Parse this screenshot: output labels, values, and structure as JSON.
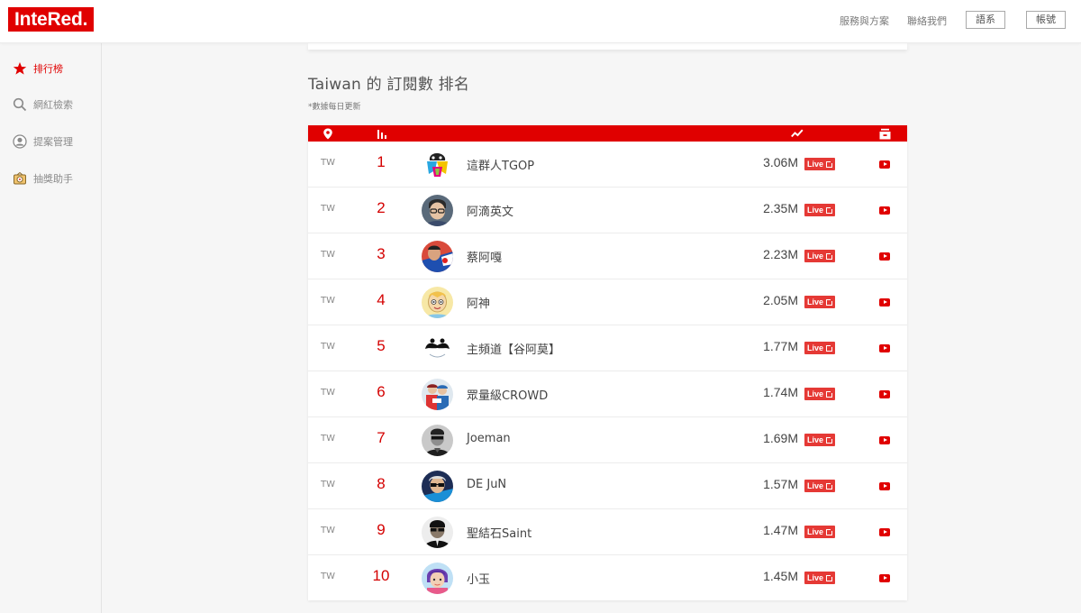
{
  "header": {
    "logo": "InteRed.",
    "nav_services": "服務與方案",
    "nav_contact": "聯絡我們",
    "btn_language": "語系",
    "btn_account": "帳號"
  },
  "sidebar": {
    "items": [
      {
        "label": "排行榜",
        "icon": "star-icon",
        "active": true
      },
      {
        "label": "網紅檢索",
        "icon": "search-icon",
        "active": false
      },
      {
        "label": "提案管理",
        "icon": "user-icon",
        "active": false
      },
      {
        "label": "抽獎助手",
        "icon": "lottery-icon",
        "active": false
      }
    ]
  },
  "main": {
    "title": "Taiwan 的 訂閱數 排名",
    "note": "*數據每日更新",
    "header_icons": [
      "location-pin-icon",
      "bar-chart-icon",
      "trend-line-icon",
      "platform-icon"
    ],
    "live_label": "Live",
    "rows": [
      {
        "country": "TW",
        "rank": "1",
        "name": "這群人TGOP",
        "subs": "3.06M"
      },
      {
        "country": "TW",
        "rank": "2",
        "name": "阿滴英文",
        "subs": "2.35M"
      },
      {
        "country": "TW",
        "rank": "3",
        "name": "蔡阿嘎",
        "subs": "2.23M"
      },
      {
        "country": "TW",
        "rank": "4",
        "name": "阿神",
        "subs": "2.05M"
      },
      {
        "country": "TW",
        "rank": "5",
        "name": "主頻道【谷阿莫】",
        "subs": "1.77M"
      },
      {
        "country": "TW",
        "rank": "6",
        "name": "眾量級CROWD",
        "subs": "1.74M"
      },
      {
        "country": "TW",
        "rank": "7",
        "name": "Joeman",
        "subs": "1.69M"
      },
      {
        "country": "TW",
        "rank": "8",
        "name": "DE JuN",
        "subs": "1.57M"
      },
      {
        "country": "TW",
        "rank": "9",
        "name": "聖結石Saint",
        "subs": "1.47M"
      },
      {
        "country": "TW",
        "rank": "10",
        "name": "小玉",
        "subs": "1.45M"
      }
    ]
  },
  "colors": {
    "brand_red": "#e00000",
    "live_red": "#e53935"
  }
}
